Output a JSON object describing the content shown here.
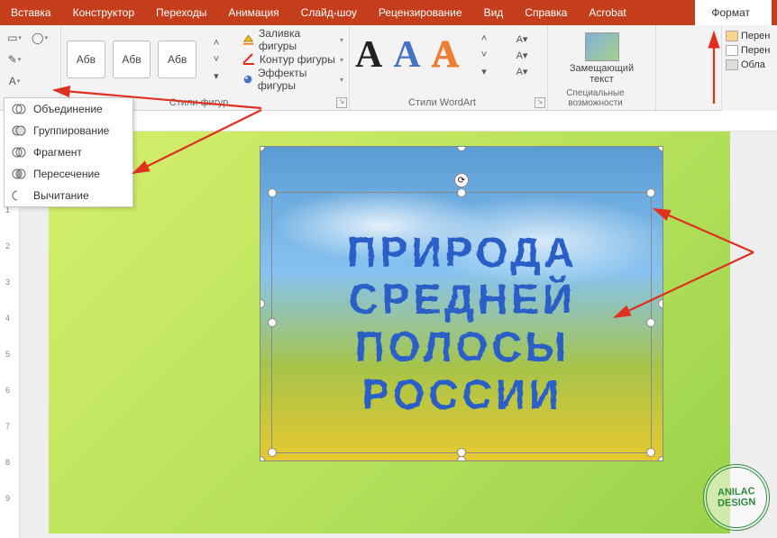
{
  "tabs": [
    "Вставка",
    "Конструктор",
    "Переходы",
    "Анимация",
    "Слайд-шоу",
    "Рецензирование",
    "Вид",
    "Справка",
    "Acrobat"
  ],
  "active_tab": "Формат",
  "ribbon": {
    "shape_styles_label": "Стили фигур",
    "wordart_styles_label": "Стили WordArt",
    "accessibility_label": "Специальные возможности",
    "style_sample_text": "Абв",
    "fill_label": "Заливка фигуры",
    "outline_label": "Контур фигуры",
    "effects_label": "Эффекты фигуры",
    "alt_text_label": "Замещающий\nтекст"
  },
  "right_pane": {
    "items": [
      "Перен",
      "Перен",
      "Обла"
    ]
  },
  "merge_menu": {
    "items": [
      "Объединение",
      "Группирование",
      "Фрагмент",
      "Пересечение",
      "Вычитание"
    ]
  },
  "slide": {
    "text_lines": [
      "ПРИРОДА",
      "СРЕДНЕЙ",
      "ПОЛОСЫ",
      "РОССИИ"
    ]
  },
  "stamp": {
    "line1": "ANILAC",
    "line2": "DESIGN"
  }
}
